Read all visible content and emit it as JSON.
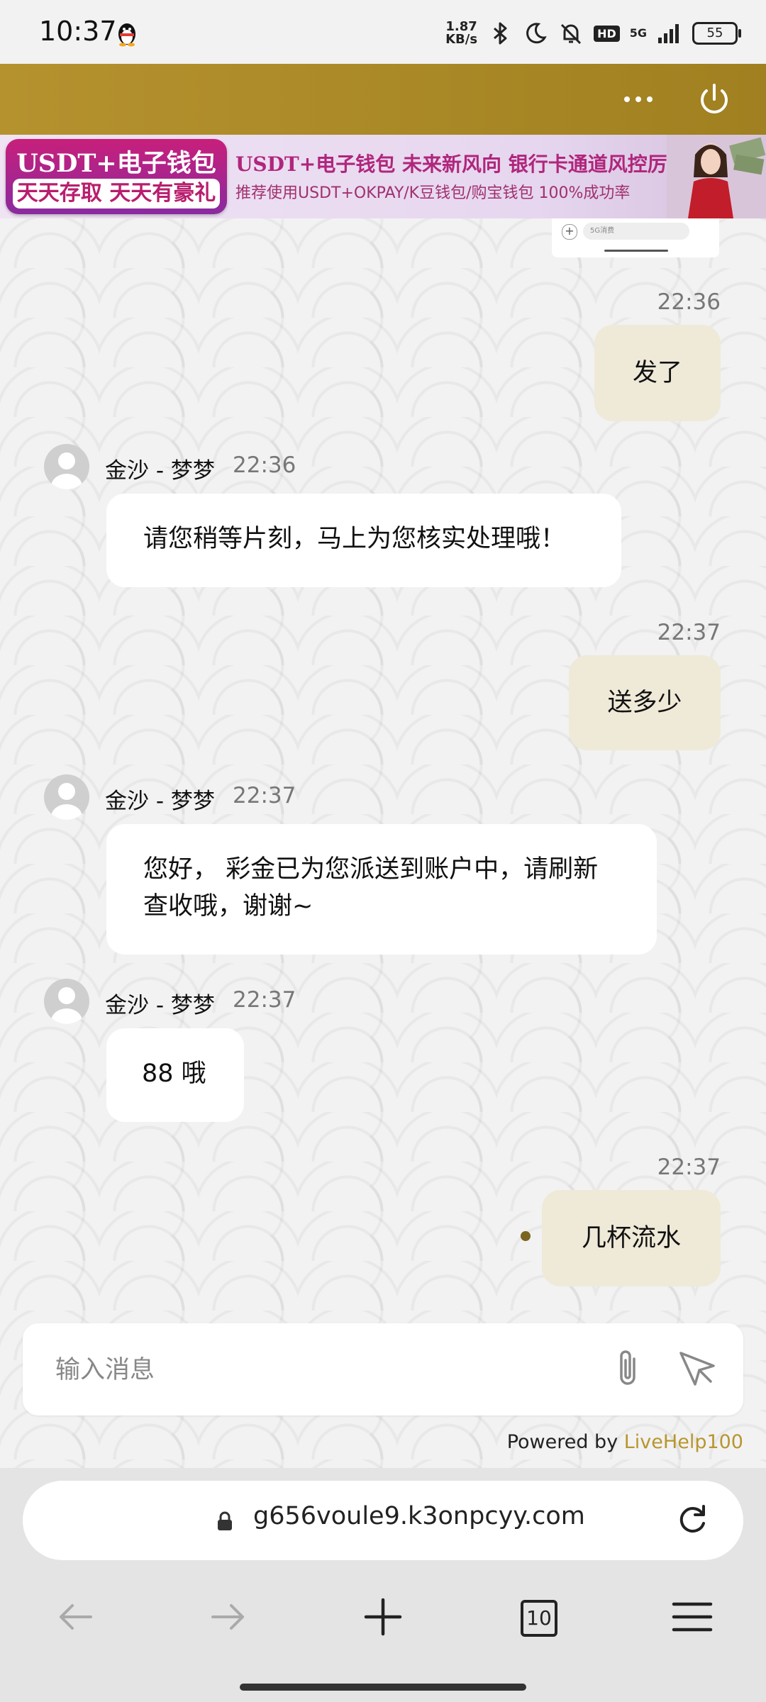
{
  "status_bar": {
    "time": "10:37",
    "app_icon": "qq-penguin-icon",
    "net_speed_value": "1.87",
    "net_speed_unit": "KB/s",
    "hd_label": "HD",
    "network_label": "5G",
    "battery": "55"
  },
  "header": {
    "more_icon": "more-dots-icon",
    "power_icon": "power-icon",
    "accent_color": "#a8892a"
  },
  "banner": {
    "left_title": "USDT+电子钱包",
    "left_subtitle": "天天存取 天天有豪礼",
    "headline": "USDT+电子钱包 未来新风向 银行卡通道风控厉害",
    "subline": "推荐使用USDT+OKPAY/K豆钱包/购宝钱包 100%成功率"
  },
  "screenshot_preview": {
    "field_text": "5G消费"
  },
  "messages": [
    {
      "side": "me",
      "time": "22:36",
      "text": "发了"
    },
    {
      "side": "agent",
      "name": "金沙 - 梦梦",
      "time": "22:36",
      "text": "请您稍等片刻，马上为您核实处理哦！"
    },
    {
      "side": "me",
      "time": "22:37",
      "text": "送多少"
    },
    {
      "side": "agent",
      "name": "金沙 - 梦梦",
      "time": "22:37",
      "text_line1": "您好， 彩金已为您派送到账户中，请刷新",
      "text_line2": "查收哦，谢谢~"
    },
    {
      "side": "agent",
      "name": "金沙 - 梦梦",
      "time": "22:37",
      "text": "88 哦"
    },
    {
      "side": "me",
      "time": "22:37",
      "text": "几杯流水"
    }
  ],
  "composer": {
    "placeholder": "输入消息",
    "attach_icon": "paperclip-icon",
    "send_icon": "send-icon"
  },
  "footer": {
    "powered_prefix": "Powered by ",
    "powered_brand": "LiveHelp100"
  },
  "browser": {
    "url": "g656voule9.k3onpcyy.com",
    "tab_count": "10"
  }
}
